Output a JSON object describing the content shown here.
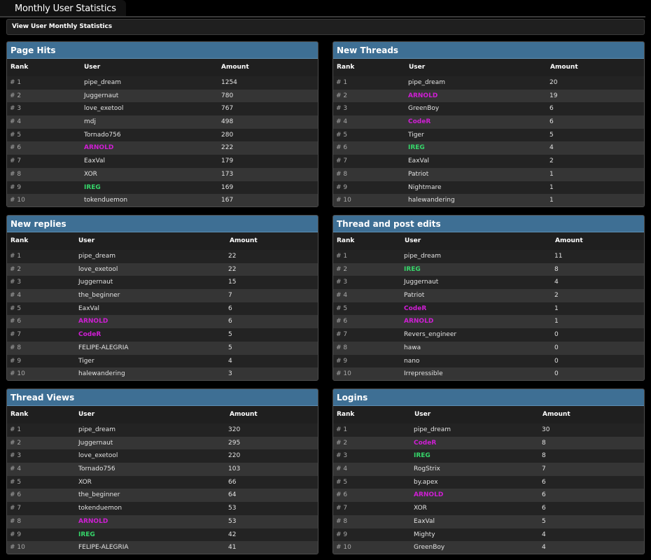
{
  "page": {
    "title": "Monthly User Statistics",
    "subnav_link": "View User Monthly Statistics",
    "colors": {
      "header_blue": "#3e6f94",
      "admin": "#cf1ed4",
      "moderator": "#36d66a"
    }
  },
  "panels": [
    {
      "title": "Page Hits",
      "col_rank": "Rank",
      "col_user": "User",
      "col_amount": "Amount",
      "rows": [
        {
          "rank": "# 1",
          "user": "pipe_dream",
          "amount": "1254",
          "style": "normal"
        },
        {
          "rank": "# 2",
          "user": "Juggernaut",
          "amount": "780",
          "style": "normal"
        },
        {
          "rank": "# 3",
          "user": "love_exetool",
          "amount": "767",
          "style": "normal"
        },
        {
          "rank": "# 4",
          "user": "mdj",
          "amount": "498",
          "style": "normal"
        },
        {
          "rank": "# 5",
          "user": "Tornado756",
          "amount": "280",
          "style": "normal"
        },
        {
          "rank": "# 6",
          "user": "ARNOLD",
          "amount": "222",
          "style": "admin"
        },
        {
          "rank": "# 7",
          "user": "EaxVal",
          "amount": "179",
          "style": "normal"
        },
        {
          "rank": "# 8",
          "user": "XOR",
          "amount": "173",
          "style": "normal"
        },
        {
          "rank": "# 9",
          "user": "IREG",
          "amount": "169",
          "style": "mod"
        },
        {
          "rank": "# 10",
          "user": "tokenduemon",
          "amount": "167",
          "style": "normal"
        }
      ]
    },
    {
      "title": "New Threads",
      "col_rank": "Rank",
      "col_user": "User",
      "col_amount": "Amount",
      "rows": [
        {
          "rank": "# 1",
          "user": "pipe_dream",
          "amount": "20",
          "style": "normal"
        },
        {
          "rank": "# 2",
          "user": "ARNOLD",
          "amount": "19",
          "style": "admin"
        },
        {
          "rank": "# 3",
          "user": "GreenBoy",
          "amount": "6",
          "style": "normal"
        },
        {
          "rank": "# 4",
          "user": "CodeR",
          "amount": "6",
          "style": "admin"
        },
        {
          "rank": "# 5",
          "user": "Tiger",
          "amount": "5",
          "style": "normal"
        },
        {
          "rank": "# 6",
          "user": "IREG",
          "amount": "4",
          "style": "mod"
        },
        {
          "rank": "# 7",
          "user": "EaxVal",
          "amount": "2",
          "style": "normal"
        },
        {
          "rank": "# 8",
          "user": "Patriot",
          "amount": "1",
          "style": "normal"
        },
        {
          "rank": "# 9",
          "user": "Nightmare",
          "amount": "1",
          "style": "normal"
        },
        {
          "rank": "# 10",
          "user": "halewandering",
          "amount": "1",
          "style": "normal"
        }
      ]
    },
    {
      "title": "New replies",
      "col_rank": "Rank",
      "col_user": "User",
      "col_amount": "Amount",
      "rows": [
        {
          "rank": "# 1",
          "user": "pipe_dream",
          "amount": "22",
          "style": "normal"
        },
        {
          "rank": "# 2",
          "user": "love_exetool",
          "amount": "22",
          "style": "normal"
        },
        {
          "rank": "# 3",
          "user": "Juggernaut",
          "amount": "15",
          "style": "normal"
        },
        {
          "rank": "# 4",
          "user": "the_beginner",
          "amount": "7",
          "style": "normal"
        },
        {
          "rank": "# 5",
          "user": "EaxVal",
          "amount": "6",
          "style": "normal"
        },
        {
          "rank": "# 6",
          "user": "ARNOLD",
          "amount": "6",
          "style": "admin"
        },
        {
          "rank": "# 7",
          "user": "CodeR",
          "amount": "5",
          "style": "admin"
        },
        {
          "rank": "# 8",
          "user": "FELIPE-ALEGRIA",
          "amount": "5",
          "style": "normal"
        },
        {
          "rank": "# 9",
          "user": "Tiger",
          "amount": "4",
          "style": "normal"
        },
        {
          "rank": "# 10",
          "user": "halewandering",
          "amount": "3",
          "style": "normal"
        }
      ]
    },
    {
      "title": "Thread and post edits",
      "col_rank": "Rank",
      "col_user": "User",
      "col_amount": "Amount",
      "rows": [
        {
          "rank": "# 1",
          "user": "pipe_dream",
          "amount": "11",
          "style": "normal"
        },
        {
          "rank": "# 2",
          "user": "IREG",
          "amount": "8",
          "style": "mod"
        },
        {
          "rank": "# 3",
          "user": "Juggernaut",
          "amount": "4",
          "style": "normal"
        },
        {
          "rank": "# 4",
          "user": "Patriot",
          "amount": "2",
          "style": "normal"
        },
        {
          "rank": "# 5",
          "user": "CodeR",
          "amount": "1",
          "style": "admin"
        },
        {
          "rank": "# 6",
          "user": "ARNOLD",
          "amount": "1",
          "style": "admin"
        },
        {
          "rank": "# 7",
          "user": "Revers_engineer",
          "amount": "0",
          "style": "normal"
        },
        {
          "rank": "# 8",
          "user": "hawa",
          "amount": "0",
          "style": "normal"
        },
        {
          "rank": "# 9",
          "user": "nano",
          "amount": "0",
          "style": "normal"
        },
        {
          "rank": "# 10",
          "user": "Irrepressible",
          "amount": "0",
          "style": "normal"
        }
      ]
    },
    {
      "title": "Thread Views",
      "col_rank": "Rank",
      "col_user": "User",
      "col_amount": "Amount",
      "rows": [
        {
          "rank": "# 1",
          "user": "pipe_dream",
          "amount": "320",
          "style": "normal"
        },
        {
          "rank": "# 2",
          "user": "Juggernaut",
          "amount": "295",
          "style": "normal"
        },
        {
          "rank": "# 3",
          "user": "love_exetool",
          "amount": "220",
          "style": "normal"
        },
        {
          "rank": "# 4",
          "user": "Tornado756",
          "amount": "103",
          "style": "normal"
        },
        {
          "rank": "# 5",
          "user": "XOR",
          "amount": "66",
          "style": "normal"
        },
        {
          "rank": "# 6",
          "user": "the_beginner",
          "amount": "64",
          "style": "normal"
        },
        {
          "rank": "# 7",
          "user": "tokenduemon",
          "amount": "53",
          "style": "normal"
        },
        {
          "rank": "# 8",
          "user": "ARNOLD",
          "amount": "53",
          "style": "admin"
        },
        {
          "rank": "# 9",
          "user": "IREG",
          "amount": "42",
          "style": "mod"
        },
        {
          "rank": "# 10",
          "user": "FELIPE-ALEGRIA",
          "amount": "41",
          "style": "normal"
        }
      ]
    },
    {
      "title": "Logins",
      "col_rank": "Rank",
      "col_user": "User",
      "col_amount": "Amount",
      "rows": [
        {
          "rank": "# 1",
          "user": "pipe_dream",
          "amount": "30",
          "style": "normal"
        },
        {
          "rank": "# 2",
          "user": "CodeR",
          "amount": "8",
          "style": "admin"
        },
        {
          "rank": "# 3",
          "user": "IREG",
          "amount": "8",
          "style": "mod"
        },
        {
          "rank": "# 4",
          "user": "RogStrix",
          "amount": "7",
          "style": "normal"
        },
        {
          "rank": "# 5",
          "user": "by.apex",
          "amount": "6",
          "style": "normal"
        },
        {
          "rank": "# 6",
          "user": "ARNOLD",
          "amount": "6",
          "style": "admin"
        },
        {
          "rank": "# 7",
          "user": "XOR",
          "amount": "6",
          "style": "normal"
        },
        {
          "rank": "# 8",
          "user": "EaxVal",
          "amount": "5",
          "style": "normal"
        },
        {
          "rank": "# 9",
          "user": "Mighty",
          "amount": "4",
          "style": "normal"
        },
        {
          "rank": "# 10",
          "user": "GreenBoy",
          "amount": "4",
          "style": "normal"
        }
      ]
    }
  ]
}
